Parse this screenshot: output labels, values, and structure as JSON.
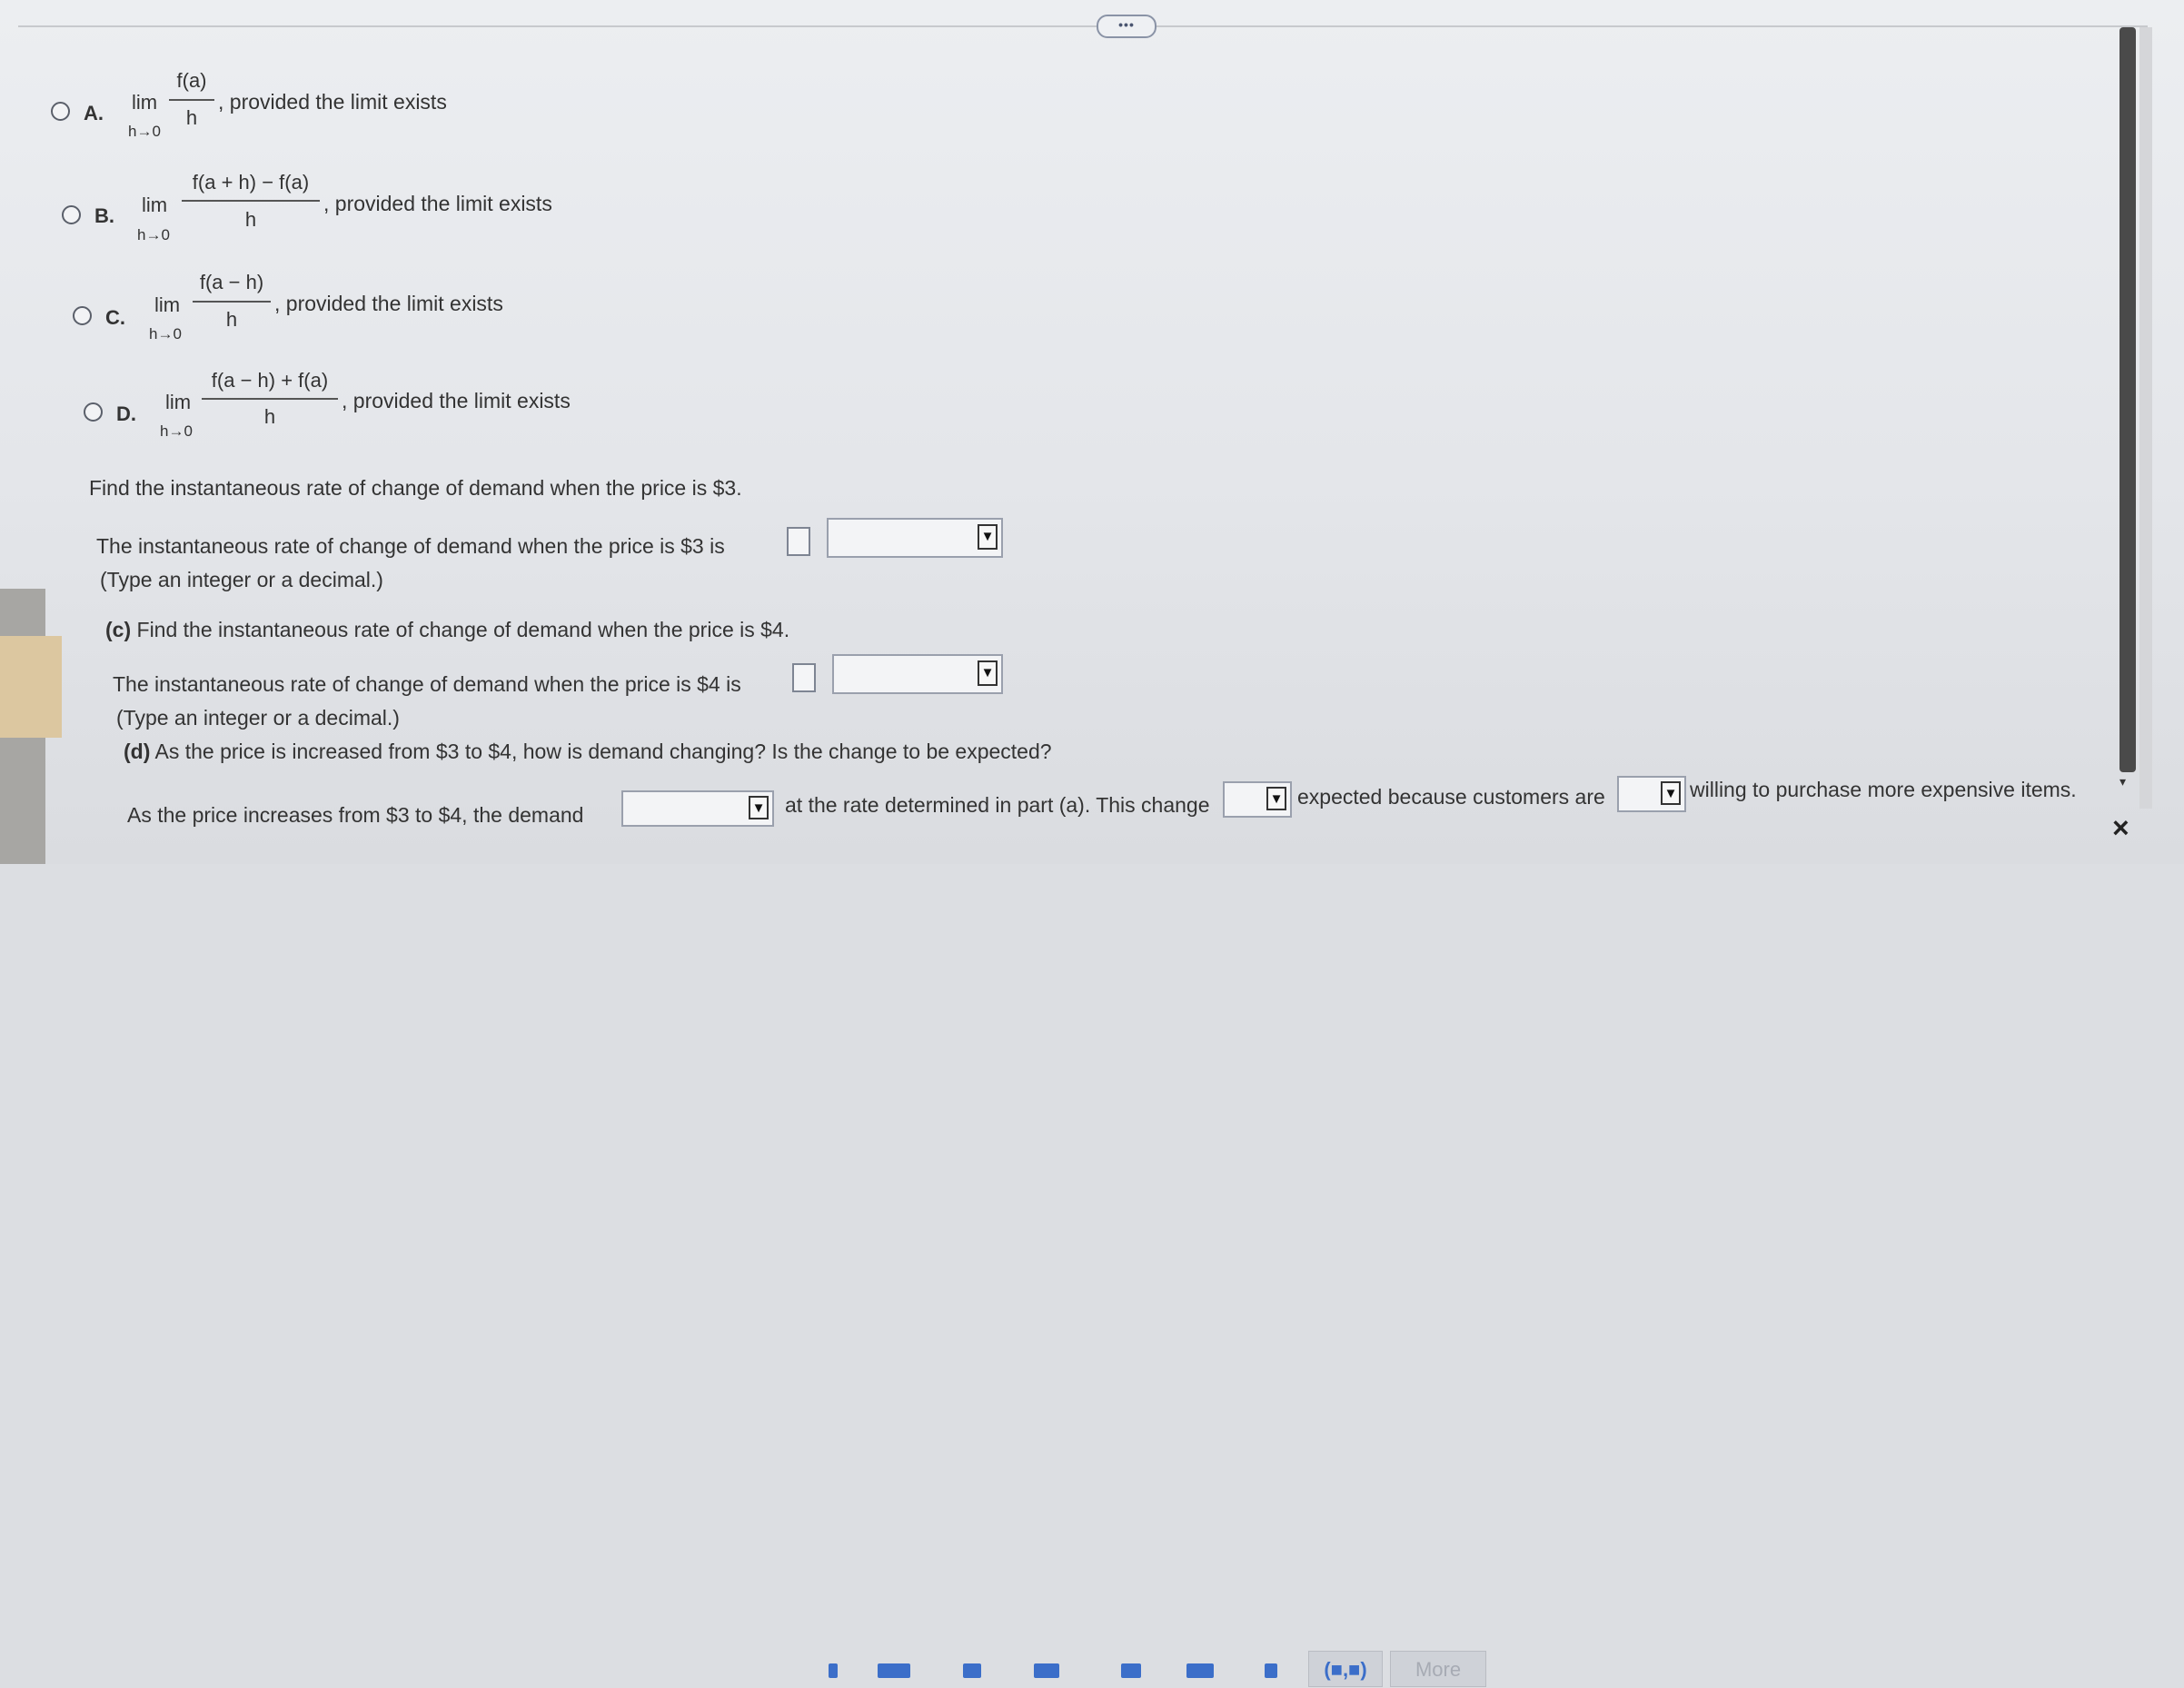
{
  "options": [
    {
      "letter": "A.",
      "lim": "lim",
      "sub": "h→0",
      "numerator": "f(a)",
      "denominator": "h",
      "tail": ", provided the limit exists"
    },
    {
      "letter": "B.",
      "lim": "lim",
      "sub": "h→0",
      "numerator": "f(a + h) − f(a)",
      "denominator": "h",
      "tail": ", provided the limit exists"
    },
    {
      "letter": "C.",
      "lim": "lim",
      "sub": "h→0",
      "numerator": "f(a − h)",
      "denominator": "h",
      "tail": ", provided the limit exists"
    },
    {
      "letter": "D.",
      "lim": "lim",
      "sub": "h→0",
      "numerator": "f(a − h) + f(a)",
      "denominator": "h",
      "tail": ", provided the limit exists"
    }
  ],
  "part_b": {
    "prompt": "Find the instantaneous rate of change of demand when the price is $3.",
    "answer_prefix": "The instantaneous rate of change of demand when the price is $3 is",
    "hint": "(Type an integer or a decimal.)"
  },
  "part_c": {
    "label": "(c)",
    "prompt": "Find the instantaneous rate of change of demand when the price is $4.",
    "answer_prefix": "The instantaneous rate of change of demand when the price is $4 is",
    "hint": "(Type an integer or a decimal.)"
  },
  "part_d": {
    "label": "(d)",
    "prompt": "As the price is increased from $3 to $4, how is demand changing? Is the change to be expected?",
    "sentence_1": "As the price increases from $3 to $4, the demand",
    "sentence_2": "at the rate determined in part (a). This change",
    "sentence_3": "expected because customers are",
    "sentence_4": "willing to purchase more expensive items."
  },
  "ui": {
    "more_dots": "•••",
    "dropdown_arrow": "▼",
    "close": "×",
    "more_label": "More",
    "scroll_down": "▾"
  }
}
